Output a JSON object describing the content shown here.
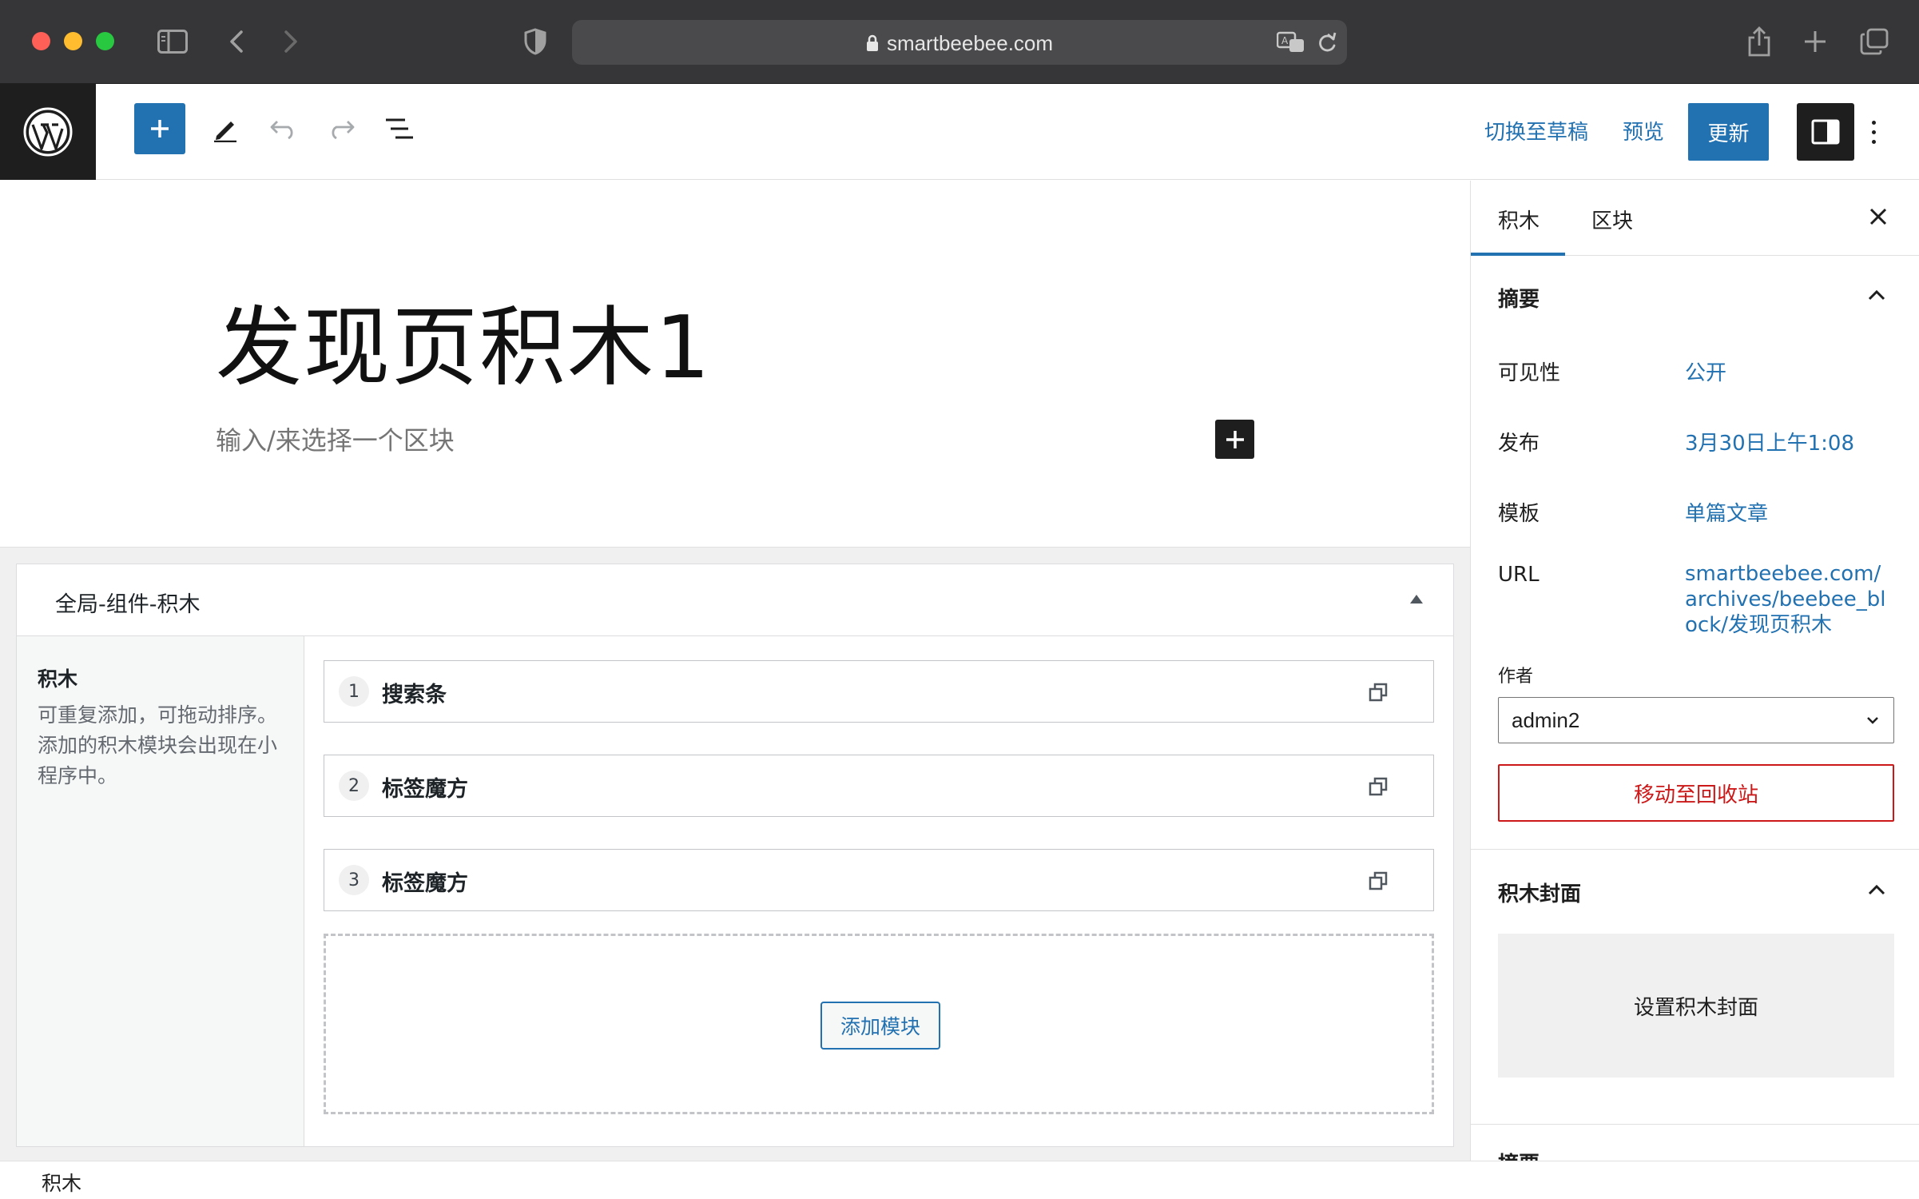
{
  "browser": {
    "url": "smartbeebee.com"
  },
  "toolbar": {
    "switch_to_draft": "切换至草稿",
    "preview": "预览",
    "update": "更新"
  },
  "editor": {
    "title": "发现页积木1",
    "placeholder": "输入/来选择一个区块"
  },
  "metabox": {
    "title": "全局-组件-积木",
    "left_title": "积木",
    "left_desc": "可重复添加，可拖动排序。添加的积木模块会出现在小程序中。",
    "modules": [
      {
        "num": "1",
        "name": "搜索条"
      },
      {
        "num": "2",
        "name": "标签魔方"
      },
      {
        "num": "3",
        "name": "标签魔方"
      }
    ],
    "add_module": "添加模块"
  },
  "sidebar": {
    "tabs": [
      "积木",
      "区块"
    ],
    "summary": {
      "title": "摘要",
      "visibility_label": "可见性",
      "visibility_value": "公开",
      "publish_label": "发布",
      "publish_value": "3月30日上午1:08",
      "template_label": "模板",
      "template_value": "单篇文章",
      "url_label": "URL",
      "url_value": "smartbeebee.com/archives/beebee_block/发现页积木",
      "author_label": "作者",
      "author_value": "admin2",
      "trash": "移动至回收站"
    },
    "cover": {
      "title": "积木封面",
      "button": "设置积木封面"
    },
    "next_panel": "摘要"
  },
  "footer": {
    "breadcrumb": "积木"
  },
  "colors": {
    "accent": "#2271b1",
    "danger": "#cc1818",
    "dark": "#1e1e1e"
  }
}
